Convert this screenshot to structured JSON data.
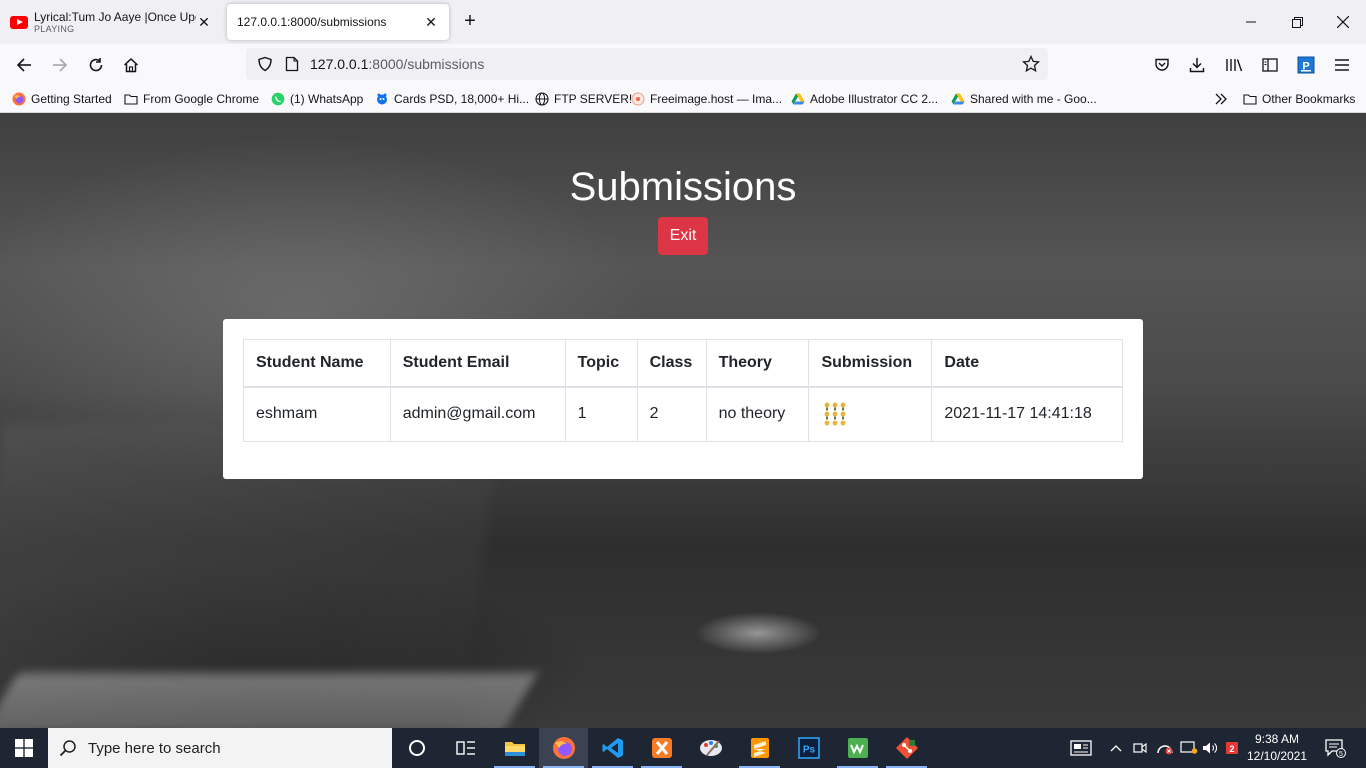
{
  "browser": {
    "tabs": [
      {
        "title": "Lyrical:Tum Jo Aaye |Once Upon",
        "status": "PLAYING"
      },
      {
        "title": "127.0.0.1:8000/submissions"
      }
    ],
    "url": {
      "host": "127.0.0.1",
      "rest": ":8000/submissions"
    },
    "bookmarks": [
      {
        "label": "Getting Started",
        "icon": "firefox-icon"
      },
      {
        "label": "From Google Chrome",
        "icon": "folder-icon"
      },
      {
        "label": "(1) WhatsApp",
        "icon": "whatsapp-icon"
      },
      {
        "label": "Cards PSD, 18,000+ Hi...",
        "icon": "freepik-icon"
      },
      {
        "label": "FTP SERVER!",
        "icon": "globe-icon"
      },
      {
        "label": "Freeimage.host — Ima...",
        "icon": "freeimage-icon"
      },
      {
        "label": "Adobe Illustrator CC 2...",
        "icon": "google-drive-icon"
      },
      {
        "label": "Shared with me - Goo...",
        "icon": "google-drive-icon"
      }
    ],
    "other_bookmarks": "Other Bookmarks"
  },
  "page": {
    "title": "Submissions",
    "exit_label": "Exit",
    "table": {
      "headers": [
        "Student Name",
        "Student Email",
        "Topic",
        "Class",
        "Theory",
        "Submission",
        "Date"
      ],
      "rows": [
        {
          "name": "eshmam",
          "email": "admin@gmail.com",
          "topic": "1",
          "class": "2",
          "theory": "no theory",
          "submission": "image-thumbnail",
          "date": "2021-11-17 14:41:18"
        }
      ]
    }
  },
  "taskbar": {
    "search_placeholder": "Type here to search",
    "time": "9:38 AM",
    "date": "12/10/2021",
    "notification_count": "5",
    "apps": [
      "cortana-icon",
      "task-view-icon",
      "file-explorer-icon",
      "firefox-icon",
      "vscode-icon",
      "xampp-icon",
      "paint-icon",
      "sublime-icon",
      "photoshop-icon",
      "wamp-icon",
      "git-icon"
    ]
  },
  "colors": {
    "exit_button": "#dc3545",
    "taskbar": "#1f2633",
    "tab_bar": "#f0f0f4"
  }
}
